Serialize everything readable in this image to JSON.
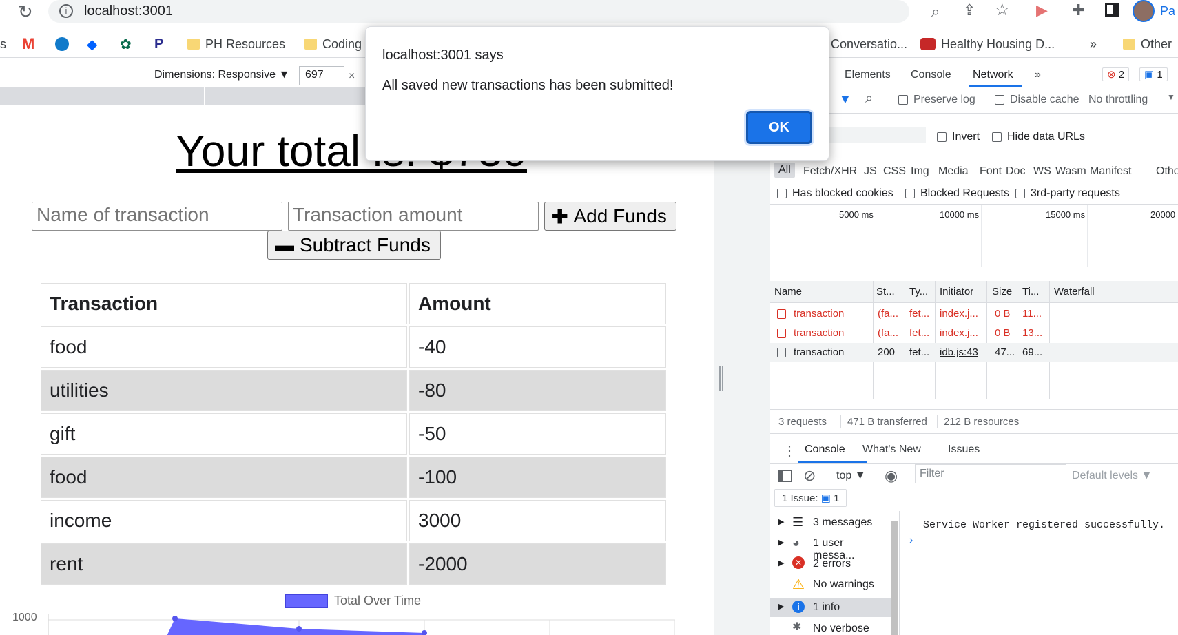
{
  "browser": {
    "url": "localhost:3001",
    "profile_initials": "Pa",
    "bookmarks": {
      "partial_left": "s",
      "ph_resources": "PH Resources",
      "coding": "Coding",
      "conversatio": "Conversatio...",
      "healthy_housing": "Healthy Housing D...",
      "more": "»",
      "other": "Other"
    }
  },
  "device_toolbar": {
    "dimensions_label": "Dimensions: Responsive ▼",
    "width_value": "697",
    "times": "×"
  },
  "app": {
    "total_title": "Your total is: $730",
    "name_placeholder": "Name of transaction",
    "amount_placeholder": "Transaction amount",
    "add_label": "Add Funds",
    "subtract_label": "Subtract Funds",
    "table": {
      "headers": [
        "Transaction",
        "Amount"
      ],
      "rows": [
        {
          "name": "food",
          "amount": "-40"
        },
        {
          "name": "utilities",
          "amount": "-80"
        },
        {
          "name": "gift",
          "amount": "-50"
        },
        {
          "name": "food",
          "amount": "-100"
        },
        {
          "name": "income",
          "amount": "3000"
        },
        {
          "name": "rent",
          "amount": "-2000"
        }
      ]
    },
    "chart_data": {
      "type": "area",
      "series": [
        {
          "name": "Total Over Time",
          "color": "#6666ff"
        }
      ],
      "y_tick_visible": "1000"
    }
  },
  "devtools": {
    "tabs": {
      "elements": "Elements",
      "console": "Console",
      "network": "Network",
      "more": "»"
    },
    "error_count": "2",
    "issue_count": "1",
    "preserve_log": "Preserve log",
    "disable_cache": "Disable cache",
    "throttling": "No throttling",
    "invert": "Invert",
    "hide_data_urls": "Hide data URLs",
    "filter_types": [
      "All",
      "Fetch/XHR",
      "JS",
      "CSS",
      "Img",
      "Media",
      "Font",
      "Doc",
      "WS",
      "Wasm",
      "Manifest",
      "Othe"
    ],
    "has_blocked_cookies": "Has blocked cookies",
    "blocked_requests": "Blocked Requests",
    "third_party": "3rd-party requests",
    "timeline_ticks": [
      "5000 ms",
      "10000 ms",
      "15000 ms",
      "20000"
    ],
    "columns": [
      "Name",
      "St...",
      "Ty...",
      "Initiator",
      "Size",
      "Ti...",
      "Waterfall"
    ],
    "requests": [
      {
        "name": "transaction",
        "status": "(fa...",
        "type": "fet...",
        "initiator": "index.j...",
        "size": "0 B",
        "time": "11...",
        "error": true
      },
      {
        "name": "transaction",
        "status": "(fa...",
        "type": "fet...",
        "initiator": "index.j...",
        "size": "0 B",
        "time": "13...",
        "error": true
      },
      {
        "name": "transaction",
        "status": "200",
        "type": "fet...",
        "initiator": "idb.js:43",
        "size": "47...",
        "time": "69...",
        "error": false
      }
    ],
    "summary": {
      "requests": "3 requests",
      "transferred": "471 B transferred",
      "resources": "212 B resources"
    },
    "drawer_tabs": {
      "console": "Console",
      "whats_new": "What's New",
      "issues": "Issues"
    },
    "context": "top ▼",
    "filter_placeholder": "Filter",
    "levels": "Default levels ▼",
    "issue_chip": "1 Issue:",
    "issue_chip_count": "1",
    "sidebar": [
      {
        "label": "3 messages",
        "icon": "list-icon"
      },
      {
        "label": "1 user messa...",
        "icon": "user-icon"
      },
      {
        "label": "2 errors",
        "icon": "error-icon"
      },
      {
        "label": "No warnings",
        "icon": "warning-icon"
      },
      {
        "label": "1 info",
        "icon": "info-icon"
      },
      {
        "label": "No verbose",
        "icon": "bug-icon"
      }
    ],
    "console_message": "Service Worker registered successfully."
  },
  "alert": {
    "title": "localhost:3001 says",
    "message": "All saved new transactions has been submitted!",
    "ok_label": "OK"
  }
}
